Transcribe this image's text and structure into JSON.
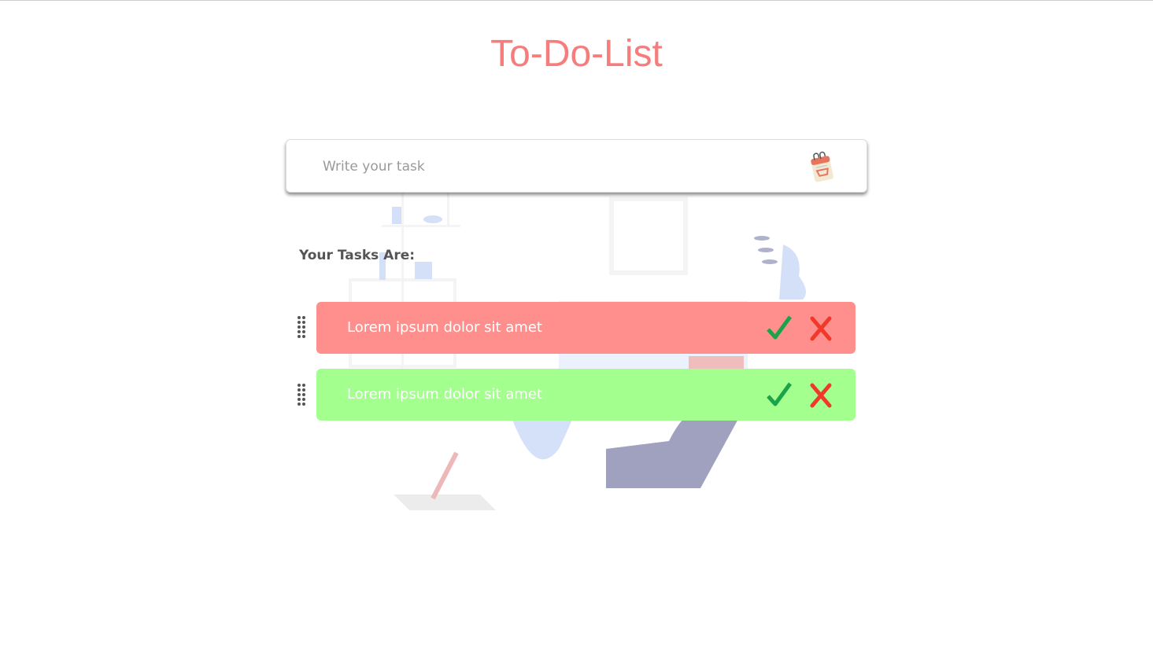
{
  "title": "To-Do-List",
  "input": {
    "placeholder": "Write your task",
    "value": ""
  },
  "tasks_heading": "Your Tasks Are:",
  "tasks": [
    {
      "text": "Lorem ipsum dolor sit amet",
      "color": "#ff8f8c"
    },
    {
      "text": "Lorem ipsum dolor sit amet",
      "color": "#a3ff8e"
    }
  ],
  "colors": {
    "title": "#f77c7c",
    "check": "#1aa34a",
    "delete": "#f0392b"
  }
}
